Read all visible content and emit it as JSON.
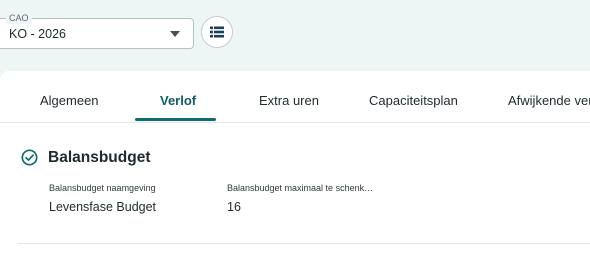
{
  "cao": {
    "label": "CAO",
    "value": "KO - 2026"
  },
  "list_button": {
    "icon": "list-icon"
  },
  "tabs": [
    {
      "label": "Algemeen",
      "active": false
    },
    {
      "label": "Verlof",
      "active": true
    },
    {
      "label": "Extra uren",
      "active": false
    },
    {
      "label": "Capaciteitsplan",
      "active": false
    },
    {
      "label": "Afwijkende verg",
      "active": false
    }
  ],
  "section": {
    "title": "Balansbudget",
    "icon": "check-circle-icon",
    "fields": [
      {
        "label": "Balansbudget naamgeving",
        "value": "Levensfase Budget"
      },
      {
        "label": "Balansbudget maximaal te schenk…",
        "value": "16"
      }
    ]
  },
  "colors": {
    "accent": "#0f6b6d",
    "background": "#eef5f5"
  }
}
